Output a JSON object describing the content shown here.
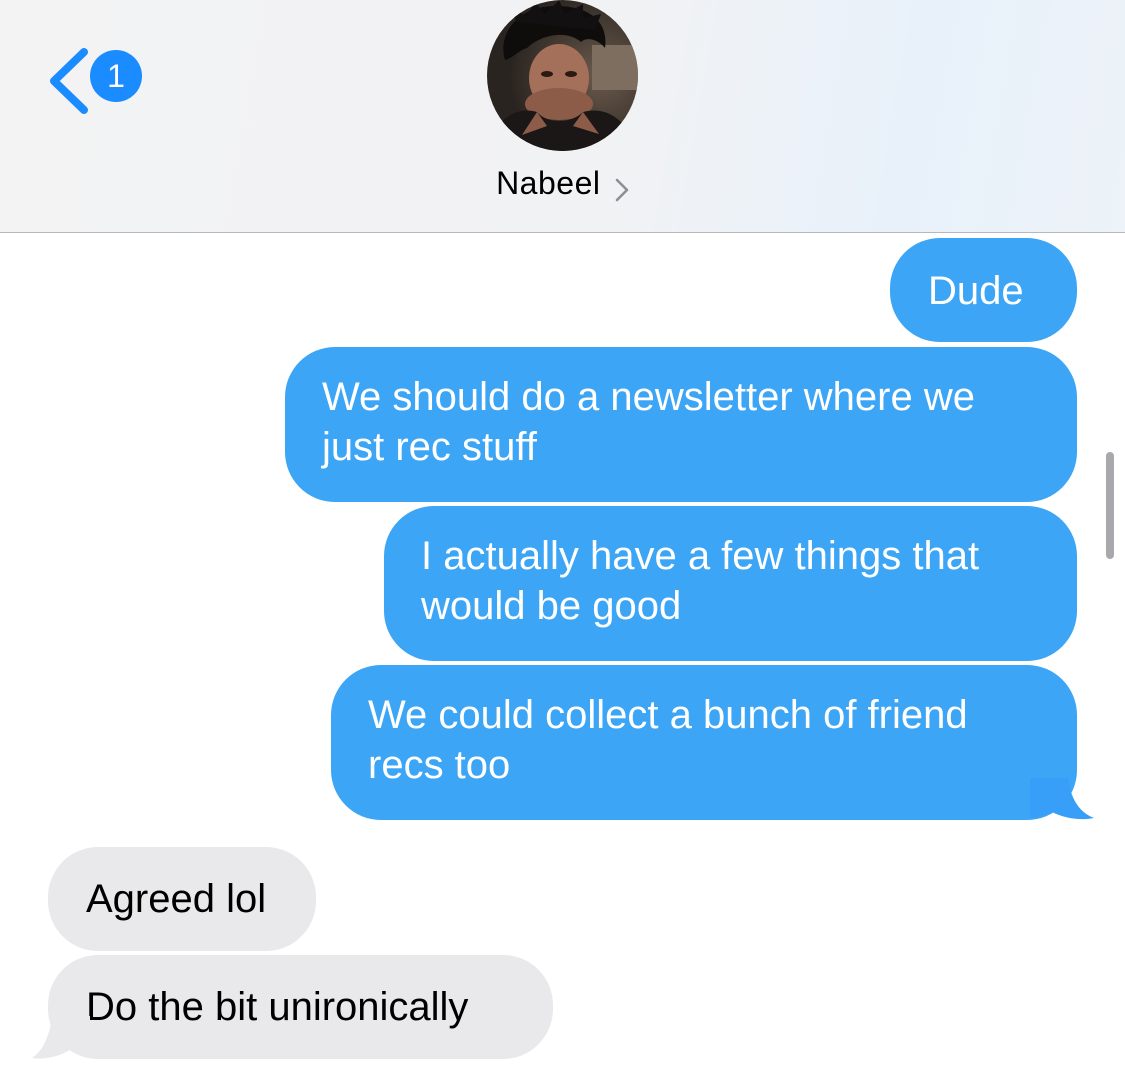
{
  "header": {
    "back_badge_count": "1",
    "contact_name": "Nabeel",
    "accent_color": "#1a8cff"
  },
  "messages": [
    {
      "direction": "sent",
      "text": "Dude"
    },
    {
      "direction": "sent",
      "text": "We should do a newsletter where we just rec stuff"
    },
    {
      "direction": "sent",
      "text": "I actually have a few things that would be good"
    },
    {
      "direction": "sent",
      "text": "We could collect a bunch of friend recs too"
    },
    {
      "direction": "received",
      "text": "Agreed lol"
    },
    {
      "direction": "received",
      "text": "Do the bit unironically"
    }
  ],
  "colors": {
    "sent_bubble": "#3ca5f5",
    "received_bubble": "#e9e9eb"
  },
  "icons": {
    "back": "chevron-left-icon",
    "contact_details": "chevron-right-icon"
  }
}
